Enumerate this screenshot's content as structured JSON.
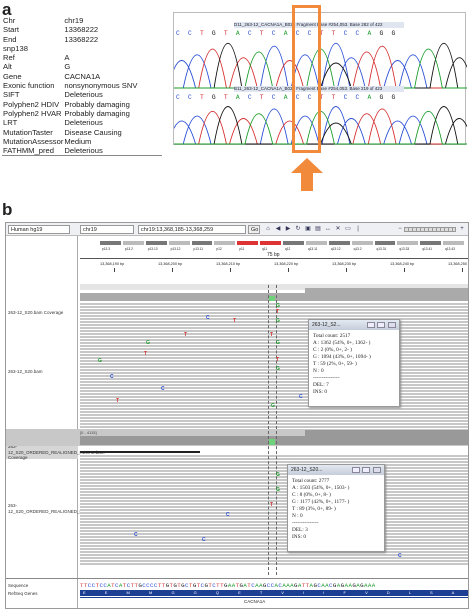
{
  "panels": {
    "a": "a",
    "b": "b"
  },
  "annotation": [
    {
      "key": "Chr",
      "value": "chr19"
    },
    {
      "key": "Start",
      "value": "13368222"
    },
    {
      "key": "End",
      "value": "13368222"
    },
    {
      "key": "snp138",
      "value": ""
    },
    {
      "key": "Ref",
      "value": "A"
    },
    {
      "key": "Alt",
      "value": "G"
    },
    {
      "key": "Gene",
      "value": "CACNA1A"
    },
    {
      "key": "Exonic function",
      "value": "nonsynonymous SNV"
    },
    {
      "key": "SIFT",
      "value": "Deleterious"
    },
    {
      "key": "Polyphen2 HDIV",
      "value": "Probably damaging"
    },
    {
      "key": "Polyphen2 HVAR",
      "value": "Probably damaging"
    },
    {
      "key": "LRT",
      "value": "Deleterious"
    },
    {
      "key": "MutationTaster",
      "value": "Disease Causing"
    },
    {
      "key": "MutationAssessor",
      "value": "Medium"
    },
    {
      "key": "FATHMM_pred",
      "value": "Deleterious"
    }
  ],
  "chromatogram": {
    "track1_title": "D11_263-12_CACNA1A_B029 Fragment Base #254,053. Base 282 of 422",
    "track2_title": "B11_263-12_CACNA1A_B029 Fragment Base #254,053. Base 219 of 423",
    "bases1": "C C T G T A C T C A C C T T C C A G G",
    "bases2": "C C T G T A C T C A C C T T C C A G G",
    "colors": {
      "A": "#1a9c2a",
      "C": "#2a4fd6",
      "G": "#111111",
      "T": "#d63030"
    }
  },
  "accent": "#f28a3c",
  "igv": {
    "genome": "Human hg19",
    "chromosome": "chr19",
    "locus": "chr19:13,368,185-13,368,259",
    "go": "Go",
    "bands": [
      "p13.3",
      "p13.2",
      "p13.13",
      "p13.12",
      "p13.11",
      "p12",
      "p11",
      "q11",
      "q12",
      "q13.11",
      "q13.12",
      "q13.2",
      "q13.31",
      "q13.33",
      "q13.41",
      "q13.43"
    ],
    "span": "75 bp",
    "ticks": [
      "13,368,190 bp",
      "13,368,200 bp",
      "13,368,210 bp",
      "13,368,220 bp",
      "13,368,230 bp",
      "13,368,240 bp",
      "13,368,250 bp"
    ],
    "tracks": {
      "cov1": "263-12_S20.bam Coverage",
      "bam1": "263-12_S20.bam",
      "cov2": "263-12_S20_ORDERED_REALIGNED_RECAL.bam Coverage",
      "bam2": "263-12_S20_ORDERED_REALIGNED_RECAL.bam",
      "seq": "Sequence",
      "genes": "RefSeq Genes"
    },
    "range_label": "[0 - 4115]",
    "popup1": {
      "title": "263-12_S2...",
      "lines": [
        "Total count: 2517",
        "A : 1362 (54%, 0+, 1362- )",
        "C : 2 (0%, 0+, 2- )",
        "G : 1094 (43%, 0+, 1094- )",
        "T : 59 (2%, 0+, 59- )",
        "N : 0",
        "---------------",
        "DEL: 7",
        "INS: 0"
      ]
    },
    "popup2": {
      "title": "263-12_S20...",
      "lines": [
        "Total count: 2777",
        "A : 1503 (54%, 0+, 1503- )",
        "C : 8 (0%, 0+, 8- )",
        "G : 1177 (42%, 0+, 1177- )",
        "T : 89 (3%, 0+, 89- )",
        "N : 0",
        "---------------",
        "DEL: 3",
        "INS: 0"
      ]
    },
    "sequence": "TTCCTCCATCATCTTGCCCCTTGTGTGCTGTCGTCTTGAATGATCAAGCCACAAAGATTAGCAACGAGAAGAGAAA",
    "amino": "E E M M G G Q E T V I I F V D L S A V V L S S",
    "gene": "CACNA1A"
  }
}
